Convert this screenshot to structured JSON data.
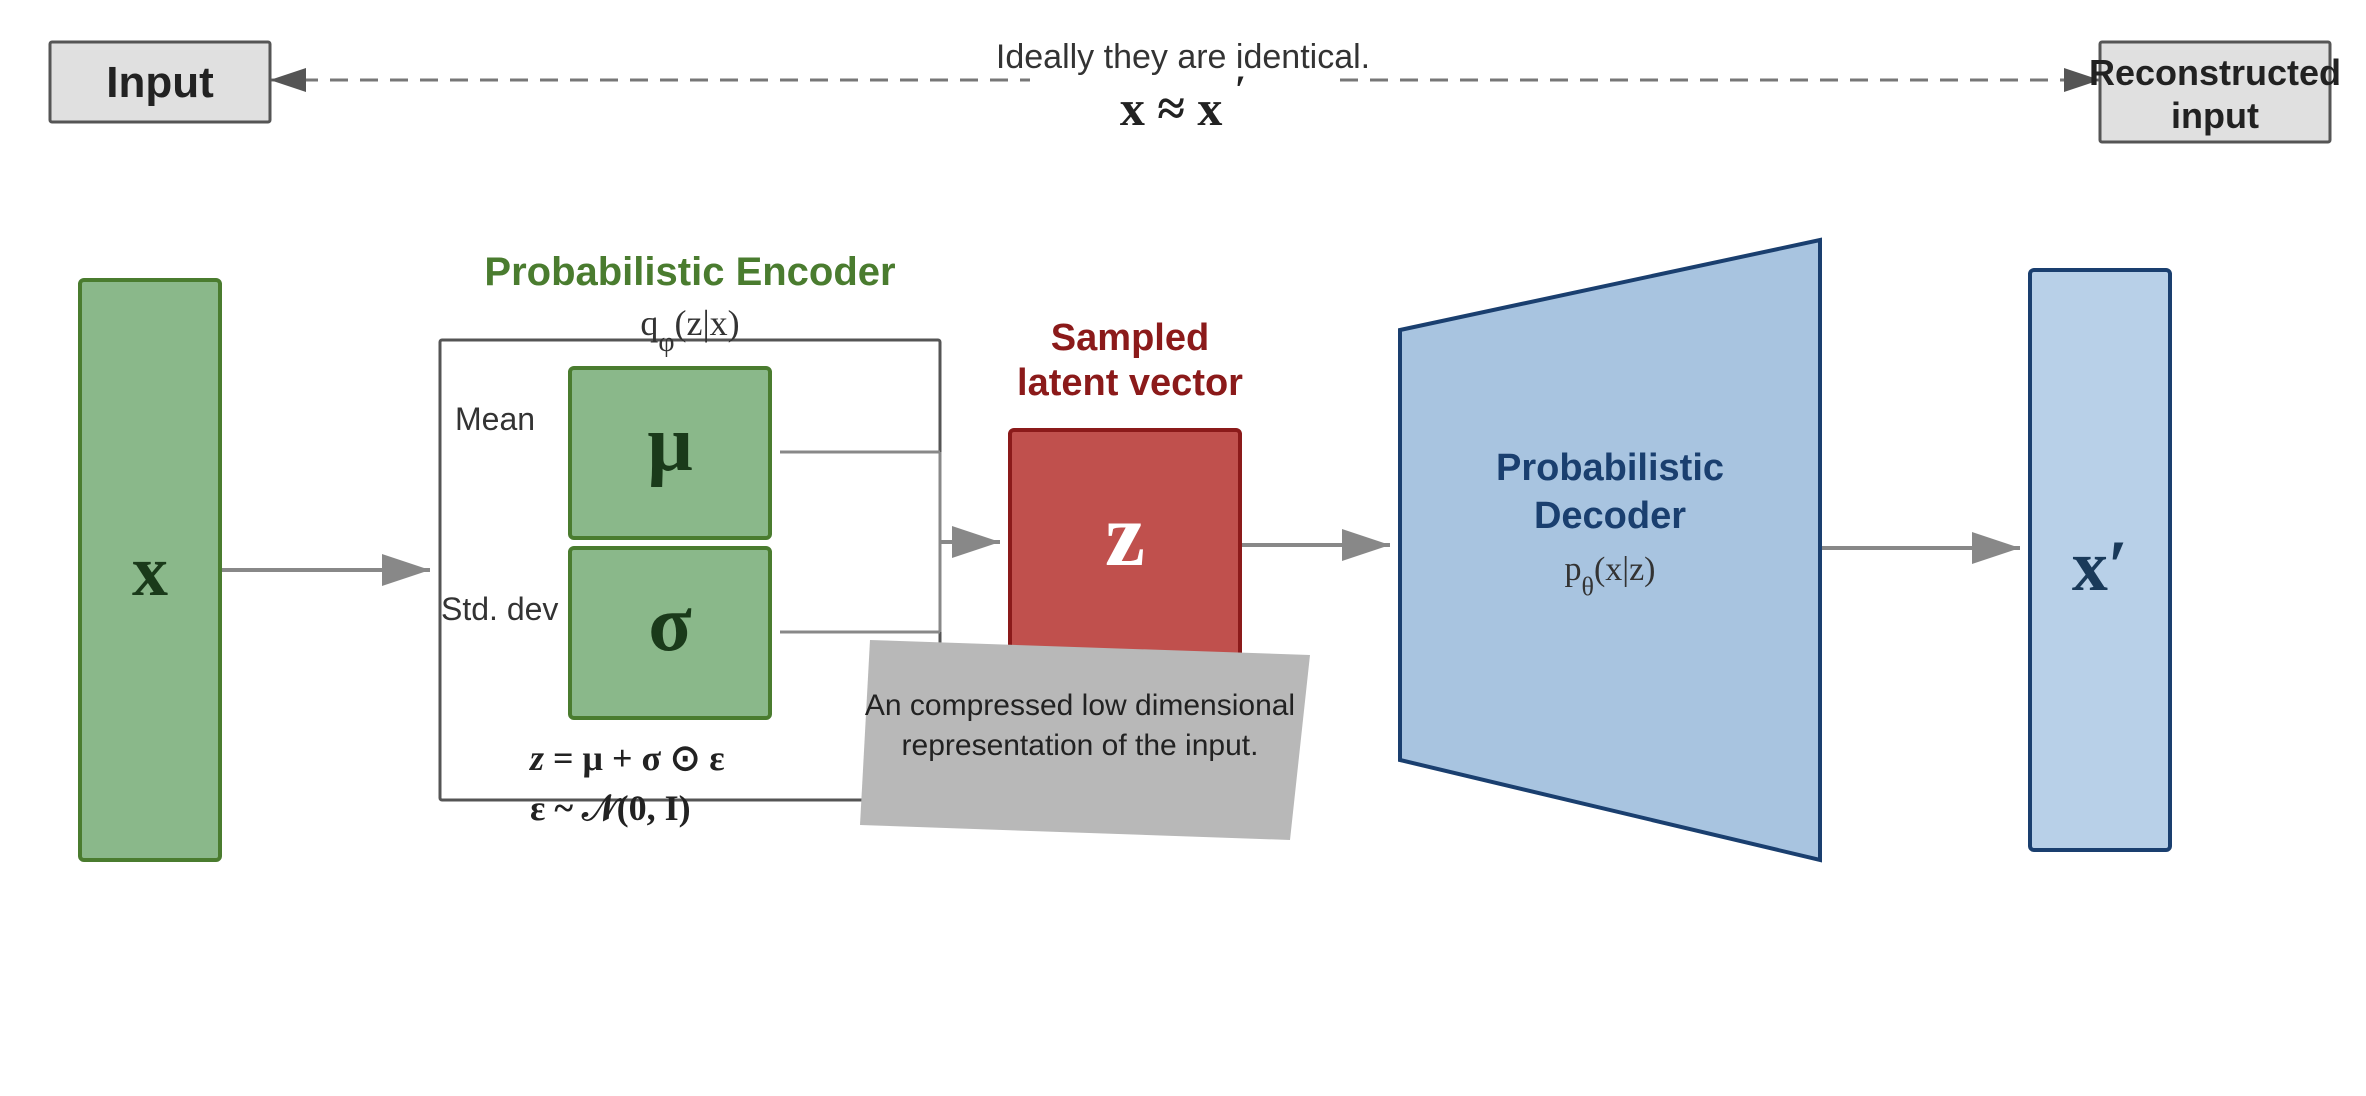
{
  "header": {
    "input_label": "Input",
    "reconstructed_label": "Reconstructed\ninput",
    "ideally_text": "Ideally they are identical.",
    "x_approx": "x ≈ x′"
  },
  "encoder": {
    "title": "Probabilistic Encoder",
    "formula": "qφ(z|x)",
    "mean_label": "Mean",
    "mu_symbol": "μ",
    "std_label": "Std. dev",
    "sigma_symbol": "σ",
    "z_formula": "z = μ + σ ⊙ ε",
    "epsilon_formula": "ε ~ 𝒩(0, I)"
  },
  "latent": {
    "title": "Sampled\nlatent vector",
    "symbol": "z",
    "compressed_text": "An compressed low dimensional\nrepresentation of the input."
  },
  "decoder": {
    "title": "Probabilistic\nDecoder",
    "formula": "pθ(x|z)",
    "output_symbol": "x′"
  },
  "colors": {
    "green_fill": "#7db87d",
    "green_border": "#4a7c2f",
    "green_label": "#4a7c2f",
    "blue_fill": "#a8c4e0",
    "blue_border": "#1a3f6f",
    "blue_label": "#1a3f6f",
    "red_fill": "#c0504d",
    "red_border": "#8b1a1a",
    "red_label": "#8b1a1a",
    "gray_box": "#e0e0e0",
    "compressed_gray": "#b0b0b0"
  }
}
